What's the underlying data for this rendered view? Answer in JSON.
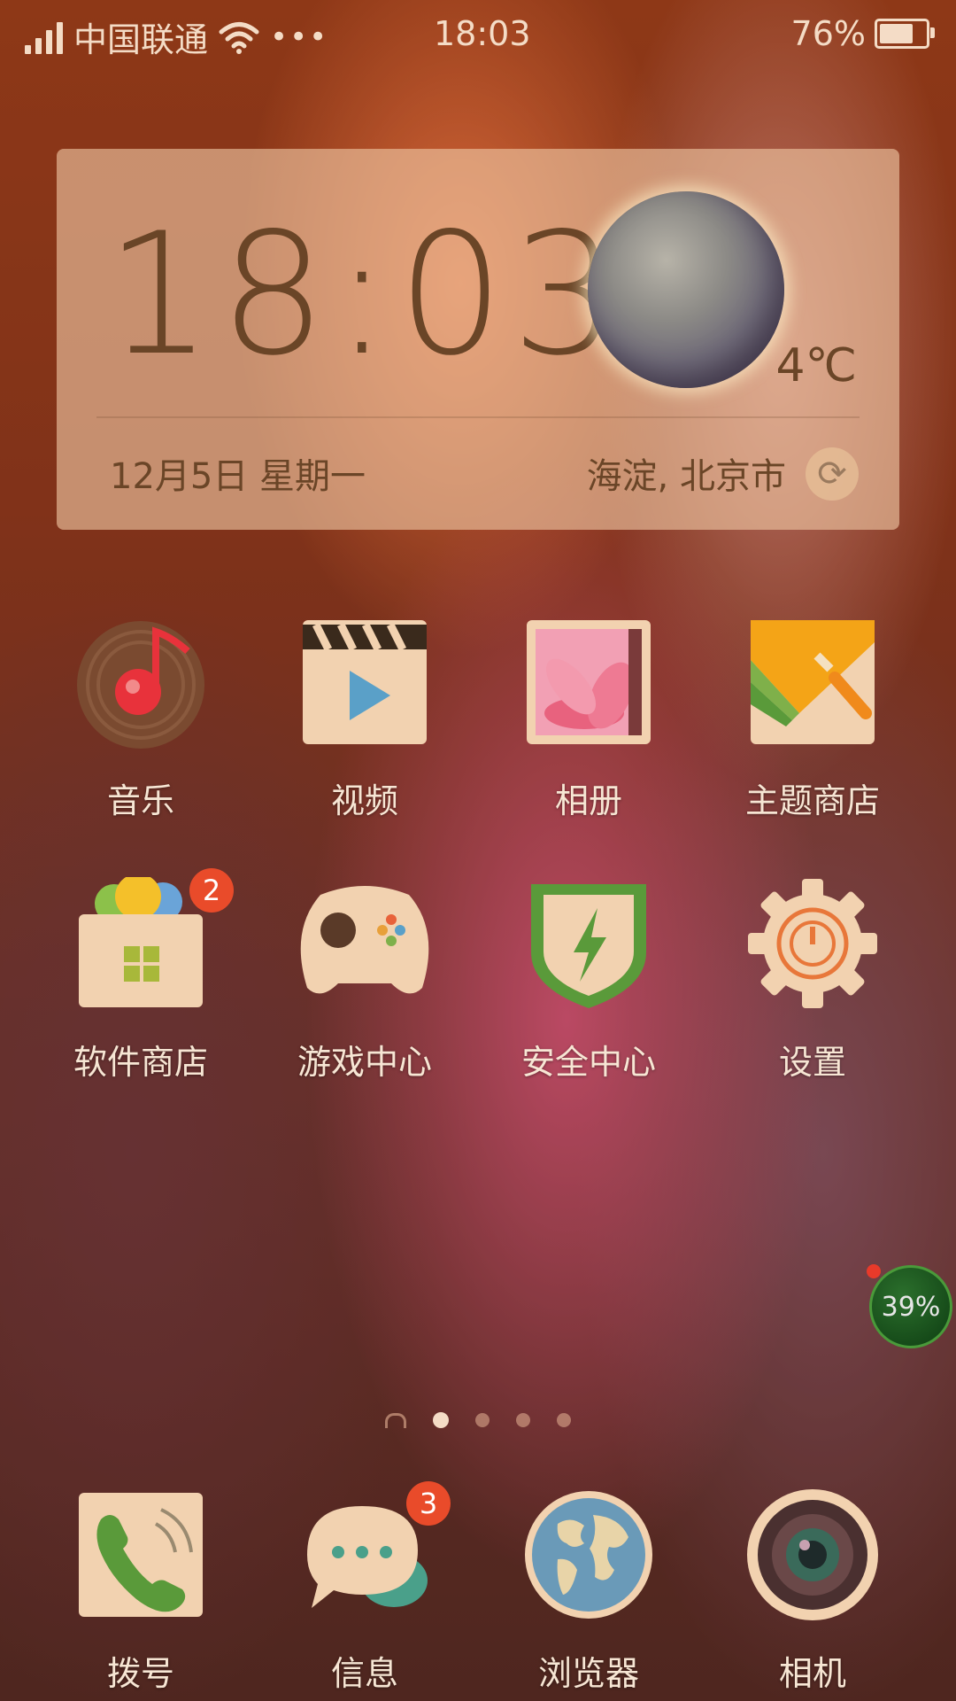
{
  "status_bar": {
    "carrier": "中国联通",
    "more": "•••",
    "time": "18:03",
    "battery": "76%",
    "battery_level": 0.76
  },
  "widget": {
    "clock": "18:03",
    "temperature": "4℃",
    "date": "12月5日 星期一",
    "location": "海淀, 北京市",
    "weather_icon": "moon-icon",
    "refresh_icon": "refresh-icon"
  },
  "apps": [
    {
      "label": "音乐",
      "icon": "music-icon"
    },
    {
      "label": "视频",
      "icon": "video-icon"
    },
    {
      "label": "相册",
      "icon": "gallery-icon"
    },
    {
      "label": "主题商店",
      "icon": "theme-store-icon"
    },
    {
      "label": "软件商店",
      "icon": "app-store-icon",
      "badge": "2"
    },
    {
      "label": "游戏中心",
      "icon": "game-center-icon"
    },
    {
      "label": "安全中心",
      "icon": "security-center-icon"
    },
    {
      "label": "设置",
      "icon": "settings-icon"
    }
  ],
  "dock": [
    {
      "label": "拨号",
      "icon": "phone-icon"
    },
    {
      "label": "信息",
      "icon": "messages-icon",
      "badge": "3"
    },
    {
      "label": "浏览器",
      "icon": "browser-icon"
    },
    {
      "label": "相机",
      "icon": "camera-icon"
    }
  ],
  "pager": {
    "pages": 4,
    "active": 1
  },
  "float_ball": {
    "label": "39%"
  }
}
